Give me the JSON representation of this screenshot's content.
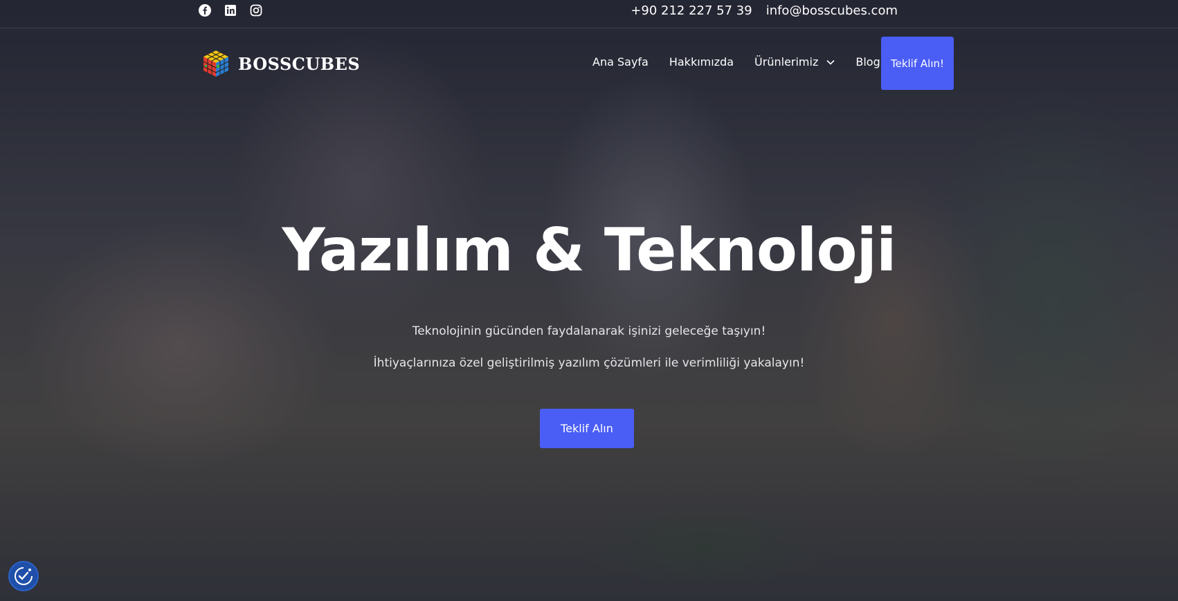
{
  "topbar": {
    "social": [
      "facebook-icon",
      "linkedin-icon",
      "instagram-icon"
    ],
    "phone": "+90 212 227 57 39",
    "email": "info@bosscubes.com"
  },
  "brand": {
    "name": "BOSSCUBES"
  },
  "nav": {
    "items": [
      {
        "label": "Ana Sayfa"
      },
      {
        "label": "Hakkımızda"
      },
      {
        "label": "Ürünlerimiz",
        "has_dropdown": true
      },
      {
        "label": "Blog"
      }
    ],
    "cta_label": "Teklif Alın!"
  },
  "hero": {
    "title": "Yazılım & Teknoloji",
    "line1": "Teknolojinin gücünden faydalanarak işinizi geleceğe taşıyın!",
    "line2": "İhtiyaçlarınıza özel geliştirilmiş yazılım çözümleri ile verimliliği yakalayın!",
    "cta_label": "Teklif Alın"
  },
  "colors": {
    "accent": "#4a5df5",
    "a11y": "#1f4fa8"
  }
}
